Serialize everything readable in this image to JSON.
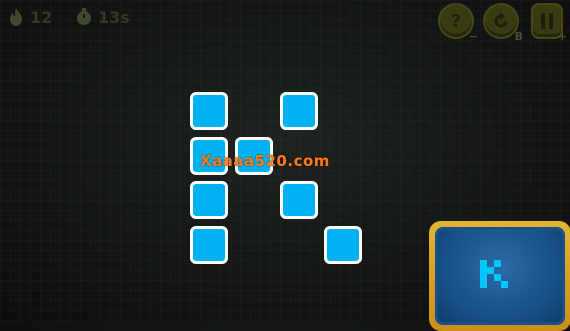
{
  "hud": {
    "moves": "12",
    "timer": "13s",
    "moves_icon": "fire-icon",
    "timer_icon": "stopwatch-icon"
  },
  "controls": {
    "hint_label": "?",
    "hint_sub": "−",
    "reset_sub": "B",
    "pause_sub": "+",
    "hint_icon": "question-icon",
    "reset_icon": "restart-icon",
    "pause_icon": "pause-icon"
  },
  "watermark": "Xaaaa520.com",
  "board": {
    "letter": "K",
    "tile_color": "#00b2f2",
    "tile_border": "#ffffff"
  },
  "preview": {
    "frame_color": "#d9a825",
    "bg_color": "#1b5a97",
    "pixel_color": "#00c6ff"
  }
}
